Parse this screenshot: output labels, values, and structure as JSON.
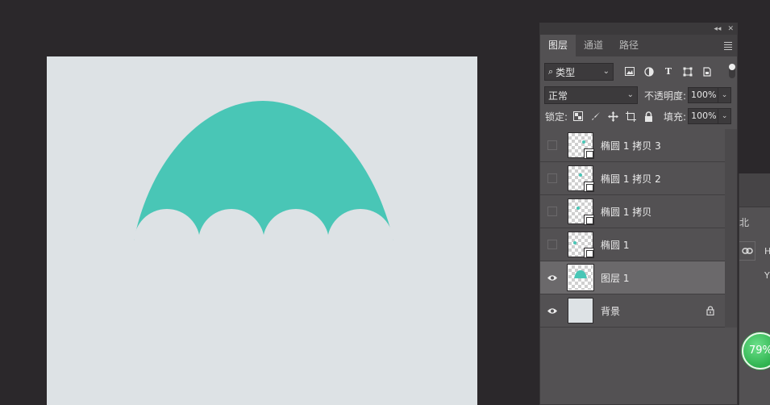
{
  "canvas": {
    "background": "#dde2e5",
    "shape_color": "#49c6b6"
  },
  "panel": {
    "tabs": [
      {
        "label": "图层",
        "active": true
      },
      {
        "label": "通道",
        "active": false
      },
      {
        "label": "路径",
        "active": false
      }
    ],
    "filter": {
      "value": "类型"
    },
    "blend": {
      "mode": "正常",
      "opacity_label": "不透明度:",
      "opacity": "100%"
    },
    "lock": {
      "label": "锁定:",
      "fill_label": "填充:",
      "fill": "100%"
    },
    "layers": [
      {
        "name": "椭圆 1 拷贝 3",
        "visible": false,
        "type": "shape"
      },
      {
        "name": "椭圆 1 拷贝 2",
        "visible": false,
        "type": "shape"
      },
      {
        "name": "椭圆 1 拷贝",
        "visible": false,
        "type": "shape"
      },
      {
        "name": "椭圆 1",
        "visible": false,
        "type": "shape"
      },
      {
        "name": "图层 1",
        "visible": true,
        "type": "pixel",
        "selected": true
      },
      {
        "name": "背景",
        "visible": true,
        "type": "background",
        "locked": true
      }
    ]
  },
  "properties_peek": {
    "text_cut": "北",
    "h_label": "H",
    "y_label": "Y"
  },
  "badge": {
    "text": "79%"
  }
}
